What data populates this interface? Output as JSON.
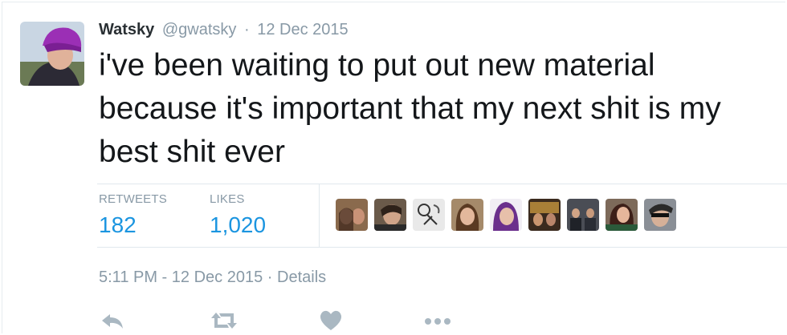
{
  "author": {
    "name": "Watsky",
    "handle": "@gwatsky",
    "date": "12 Dec 2015",
    "separator": "·"
  },
  "tweet": {
    "text": "i've been waiting to put out new material because it's important that my next shit is my best shit ever"
  },
  "stats": {
    "retweets_label": "RETWEETS",
    "retweets_value": "182",
    "likes_label": "LIKES",
    "likes_value": "1,020"
  },
  "likers_count_shown": 9,
  "meta": {
    "timestamp": "5:11 PM - 12 Dec 2015",
    "separator": "·",
    "details": "Details"
  },
  "actions": [
    {
      "name": "reply-button",
      "icon": "reply-icon"
    },
    {
      "name": "retweet-button",
      "icon": "retweet-icon"
    },
    {
      "name": "like-button",
      "icon": "heart-icon"
    },
    {
      "name": "more-button",
      "icon": "more-dots-icon"
    }
  ],
  "colors": {
    "link_blue": "#1b95e0",
    "muted_gray": "#8899a6",
    "icon_gray": "#aab8c2",
    "text_dark": "#14171a",
    "border": "#e1e8ed"
  }
}
